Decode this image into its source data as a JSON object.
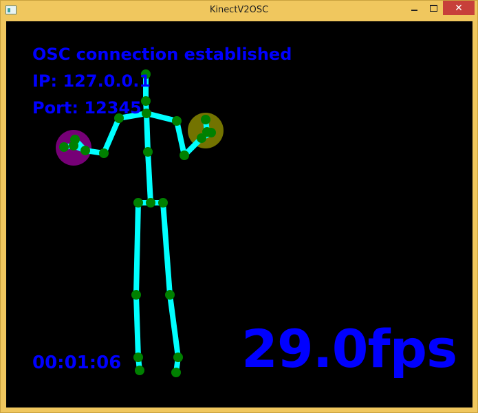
{
  "window": {
    "title": "KinectV2OSC",
    "close_glyph": "✕"
  },
  "overlay": {
    "status": "OSC connection established",
    "ip": "IP: 127.0.0.1",
    "port": "Port: 12345",
    "elapsed": "00:01:06",
    "fps": "29.0fps"
  },
  "colors": {
    "bone": "#00ffff",
    "joint": "#008000",
    "text": "#0000ff",
    "left_hand_state": "#8b008b",
    "right_hand_state": "#808000",
    "background": "#000000"
  }
}
